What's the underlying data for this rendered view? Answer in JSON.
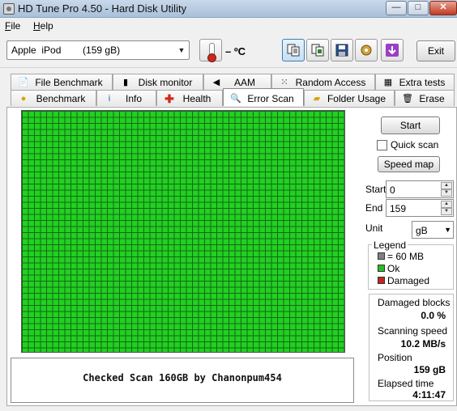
{
  "window": {
    "title": "HD Tune Pro 4.50 - Hard Disk Utility",
    "min_glyph": "—",
    "max_glyph": "□",
    "close_glyph": "✕"
  },
  "menu": {
    "file": "File",
    "help": "Help"
  },
  "toolbar": {
    "drive": "Apple  iPod        (159 gB)",
    "temperature": "– ºC",
    "exit": "Exit",
    "icons": [
      "copy-text-icon",
      "copy-screenshot-icon",
      "save-icon",
      "options-icon",
      "download-icon"
    ]
  },
  "tabs_top": [
    "File Benchmark",
    "Disk monitor",
    "AAM",
    "Random Access",
    "Extra tests"
  ],
  "tabs_bottom": [
    "Benchmark",
    "Info",
    "Health",
    "Error Scan",
    "Folder Usage",
    "Erase"
  ],
  "active_tab": "Error Scan",
  "controls": {
    "start_button": "Start",
    "quick_scan_label": "Quick scan",
    "quick_scan_checked": false,
    "speed_map_button": "Speed map",
    "start_label": "Start",
    "start_value": "0",
    "end_label": "End",
    "end_value": "159",
    "unit_label": "Unit",
    "unit_value": "gB"
  },
  "legend": {
    "title": "Legend",
    "items": [
      {
        "label": "= 60 MB",
        "color": "#808080"
      },
      {
        "label": "Ok",
        "color": "#22c022"
      },
      {
        "label": "Damaged",
        "color": "#c0281e"
      }
    ]
  },
  "stats": {
    "damaged_blocks_label": "Damaged blocks",
    "damaged_blocks_value": "0.0 %",
    "scanning_speed_label": "Scanning speed",
    "scanning_speed_value": "10.2 MB/s",
    "position_label": "Position",
    "position_value": "159 gB",
    "elapsed_label": "Elapsed time",
    "elapsed_value": "4:11:47"
  },
  "info_text": "Checked Scan 160GB by Chanonpum454",
  "colors": {
    "block_ok": "#22d022",
    "grid_line": "#146914"
  }
}
